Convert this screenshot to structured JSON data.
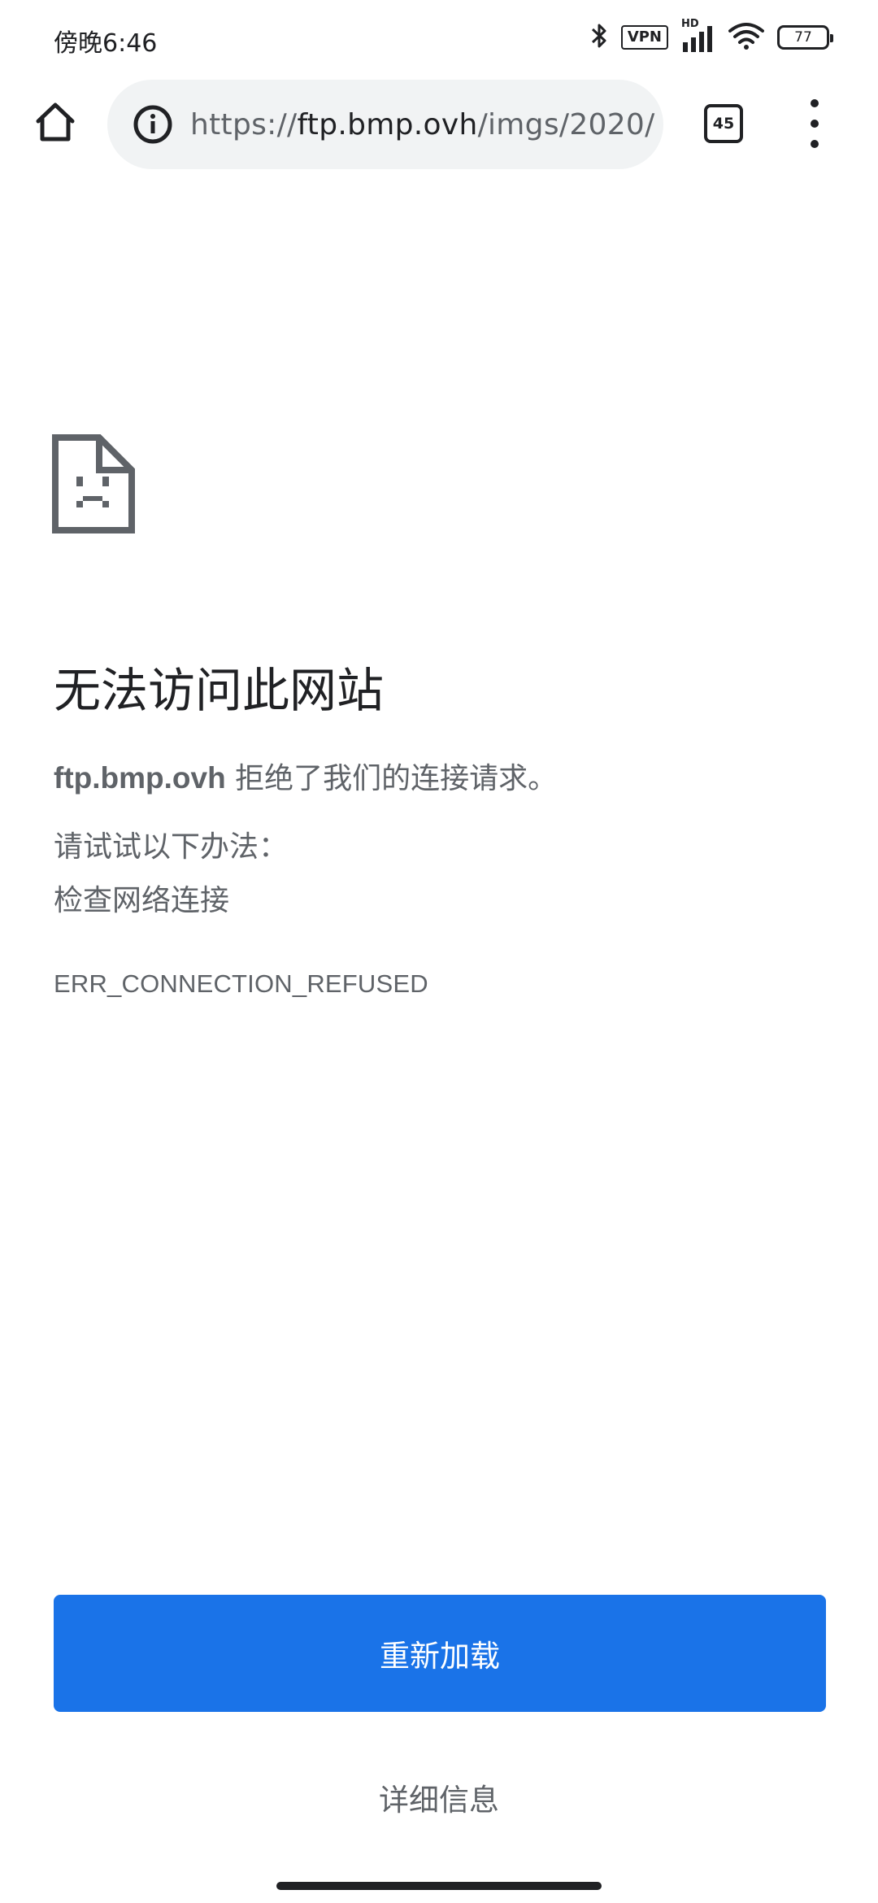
{
  "status_bar": {
    "time": "傍晚6:46",
    "vpn_label": "VPN",
    "network_label": "HD",
    "battery_level": "77",
    "icons": [
      "bluetooth-icon",
      "vpn-icon",
      "cellular-signal-icon",
      "wifi-icon",
      "battery-icon"
    ]
  },
  "toolbar": {
    "url_scheme": "https://",
    "url_host": "ftp.bmp.ovh",
    "url_path": "/imgs/2020/",
    "tab_count": "45",
    "icons": [
      "home-icon",
      "info-icon",
      "tab-switcher-icon",
      "more-menu-icon"
    ]
  },
  "error": {
    "title": "无法访问此网站",
    "host": "ftp.bmp.ovh",
    "message": " 拒绝了我们的连接请求。",
    "suggestions_heading": "请试试以下办法：",
    "suggestions": [
      "检查网络连接"
    ],
    "code": "ERR_CONNECTION_REFUSED",
    "icon": "sad-page-icon"
  },
  "actions": {
    "reload_label": "重新加载",
    "details_label": "详细信息"
  },
  "colors": {
    "primary_button": "#1a73e8",
    "text_primary": "#202124",
    "text_secondary": "#5f6368",
    "omnibox_background": "#f1f3f4"
  }
}
